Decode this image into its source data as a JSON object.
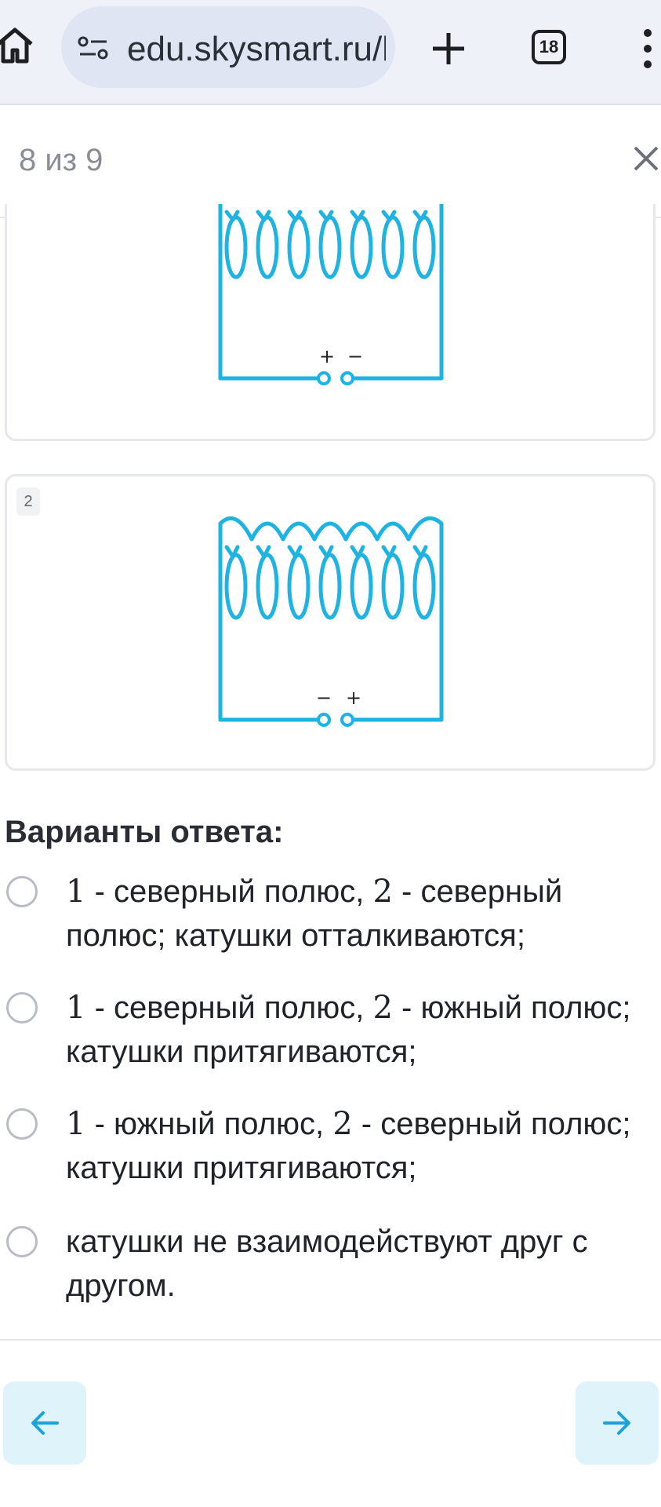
{
  "browser": {
    "url": "edu.skysmart.ru/l",
    "tab_count": "18"
  },
  "quiz": {
    "progress": "8 из 9"
  },
  "cards": [
    {
      "polarity_left": "+",
      "polarity_right": "−"
    },
    {
      "number": "2",
      "polarity_left": "−",
      "polarity_right": "+"
    }
  ],
  "answers": {
    "title": "Варианты ответа:",
    "options": [
      {
        "n1": "1",
        "a": " - северный полюс, ",
        "n2": "2",
        "b": " - северный полюс; катушки отталкиваются;"
      },
      {
        "n1": "1",
        "a": " - северный полюс, ",
        "n2": "2",
        "b": " - южный полюс; катушки притягиваются;"
      },
      {
        "n1": "1",
        "a": " - южный полюс, ",
        "n2": "2",
        "b": " - северный полюс; катушки притягиваются;"
      },
      {
        "text": "катушки не взаимодействуют друг с другом."
      }
    ]
  },
  "colors": {
    "coil": "#1fb3e2",
    "nav_bg": "#dff3fa",
    "nav_arrow": "#1fa2d6"
  }
}
